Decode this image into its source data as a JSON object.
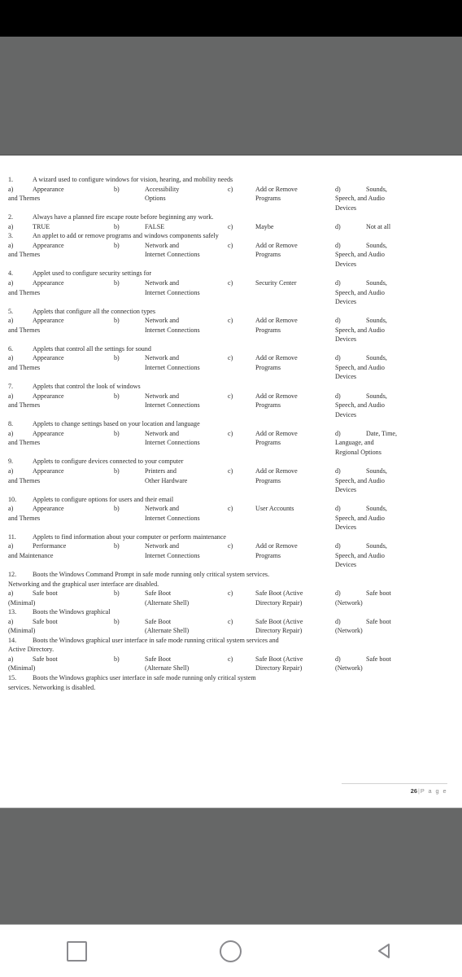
{
  "app": {
    "status_bar_color": "#000000",
    "reader_background_color": "#666767",
    "page_background_color": "#ffffff"
  },
  "document": {
    "footer": {
      "page_number": "26",
      "separator": "|",
      "page_word": "P a g e"
    },
    "questions": [
      {
        "number": "1.",
        "stem": "A wizard used to configure windows for vision, hearing, and mobility needs",
        "options": {
          "a": {
            "letter": "a)",
            "line1": "Appearance",
            "line2": "and Themes",
            "line3": ""
          },
          "b": {
            "letter": "b)",
            "line1": "Accessibility",
            "line2": "Options",
            "line3": ""
          },
          "c": {
            "letter": "c)",
            "line1": "Add or Remove",
            "line2": "Programs",
            "line3": ""
          },
          "d": {
            "letter": "d)",
            "line1": "Sounds,",
            "line2": "Speech, and Audio",
            "line3": "Devices"
          }
        }
      },
      {
        "number": "2.",
        "stem": "Always have a planned fire escape route before beginning any work.",
        "options": {
          "a": {
            "letter": "a)",
            "line1": "TRUE",
            "line2": "",
            "line3": ""
          },
          "b": {
            "letter": "b)",
            "line1": "FALSE",
            "line2": "",
            "line3": ""
          },
          "c": {
            "letter": "c)",
            "line1": "Maybe",
            "line2": "",
            "line3": ""
          },
          "d": {
            "letter": "d)",
            "line1": "Not at all",
            "line2": "",
            "line3": ""
          }
        }
      },
      {
        "number": "3.",
        "stem": "An applet to add or remove programs and windows components safely",
        "options": {
          "a": {
            "letter": "a)",
            "line1": "Appearance",
            "line2": "and Themes",
            "line3": ""
          },
          "b": {
            "letter": "b)",
            "line1": "Network and",
            "line2": "Internet Connections",
            "line3": ""
          },
          "c": {
            "letter": "c)",
            "line1": "Add or Remove",
            "line2": "Programs",
            "line3": ""
          },
          "d": {
            "letter": "d)",
            "line1": "Sounds,",
            "line2": "Speech, and Audio",
            "line3": "Devices"
          }
        }
      },
      {
        "number": "4.",
        "stem": "Applet used to configure security settings for",
        "options": {
          "a": {
            "letter": "a)",
            "line1": "Appearance",
            "line2": "and Themes",
            "line3": ""
          },
          "b": {
            "letter": "b)",
            "line1": "Network and",
            "line2": "Internet Connections",
            "line3": ""
          },
          "c": {
            "letter": "c)",
            "line1": "Security Center",
            "line2": "",
            "line3": ""
          },
          "d": {
            "letter": "d)",
            "line1": "Sounds,",
            "line2": "Speech, and Audio",
            "line3": "Devices"
          }
        }
      },
      {
        "number": "5.",
        "stem": "Applets that configure all the connection types",
        "options": {
          "a": {
            "letter": "a)",
            "line1": "Appearance",
            "line2": "and Themes",
            "line3": ""
          },
          "b": {
            "letter": "b)",
            "line1": "Network and",
            "line2": "Internet Connections",
            "line3": ""
          },
          "c": {
            "letter": "c)",
            "line1": "Add or Remove",
            "line2": "Programs",
            "line3": ""
          },
          "d": {
            "letter": "d)",
            "line1": "Sounds,",
            "line2": "Speech, and Audio",
            "line3": "Devices"
          }
        }
      },
      {
        "number": "6.",
        "stem": "Applets that control all the settings for sound",
        "options": {
          "a": {
            "letter": "a)",
            "line1": "Appearance",
            "line2": "and Themes",
            "line3": ""
          },
          "b": {
            "letter": "b)",
            "line1": "Network and",
            "line2": "Internet Connections",
            "line3": ""
          },
          "c": {
            "letter": "c)",
            "line1": "Add or Remove",
            "line2": "Programs",
            "line3": ""
          },
          "d": {
            "letter": "d)",
            "line1": "Sounds,",
            "line2": "Speech, and Audio",
            "line3": "Devices"
          }
        }
      },
      {
        "number": "7.",
        "stem": "Applets that control the look of windows",
        "options": {
          "a": {
            "letter": "a)",
            "line1": "Appearance",
            "line2": "and Themes",
            "line3": ""
          },
          "b": {
            "letter": "b)",
            "line1": "Network and",
            "line2": "Internet Connections",
            "line3": ""
          },
          "c": {
            "letter": "c)",
            "line1": "Add or Remove",
            "line2": "Programs",
            "line3": ""
          },
          "d": {
            "letter": "d)",
            "line1": "Sounds,",
            "line2": "Speech, and Audio",
            "line3": "Devices"
          }
        }
      },
      {
        "number": "8.",
        "stem": "Applets to change settings based on your location and language",
        "options": {
          "a": {
            "letter": "a)",
            "line1": "Appearance",
            "line2": "and Themes",
            "line3": ""
          },
          "b": {
            "letter": "b)",
            "line1": "Network and",
            "line2": "Internet Connections",
            "line3": ""
          },
          "c": {
            "letter": "c)",
            "line1": "Add or Remove",
            "line2": "Programs",
            "line3": ""
          },
          "d": {
            "letter": "d)",
            "line1": "Date, Time,",
            "line2": "Language, and",
            "line3": "Regional Options"
          }
        }
      },
      {
        "number": "9.",
        "stem": "Applets to configure devices connected to your computer",
        "options": {
          "a": {
            "letter": "a)",
            "line1": "Appearance",
            "line2": "and Themes",
            "line3": ""
          },
          "b": {
            "letter": "b)",
            "line1": "Printers and",
            "line2": "Other Hardware",
            "line3": ""
          },
          "c": {
            "letter": "c)",
            "line1": "Add or Remove",
            "line2": "Programs",
            "line3": ""
          },
          "d": {
            "letter": "d)",
            "line1": "Sounds,",
            "line2": "Speech, and Audio",
            "line3": "Devices"
          }
        }
      },
      {
        "number": "10.",
        "stem": "Applets to configure options for users and their email",
        "options": {
          "a": {
            "letter": "a)",
            "line1": "Appearance",
            "line2": "and Themes",
            "line3": ""
          },
          "b": {
            "letter": "b)",
            "line1": "Network and",
            "line2": "Internet Connections",
            "line3": ""
          },
          "c": {
            "letter": "c)",
            "line1": "User Accounts",
            "line2": "",
            "line3": ""
          },
          "d": {
            "letter": "d)",
            "line1": "Sounds,",
            "line2": "Speech, and Audio",
            "line3": "Devices"
          }
        }
      },
      {
        "number": "11.",
        "stem": "Applets to find information about your computer or perform maintenance",
        "options": {
          "a": {
            "letter": "a)",
            "line1": "Performance",
            "line2": "and Maintenance",
            "line3": ""
          },
          "b": {
            "letter": "b)",
            "line1": "Network and",
            "line2": "Internet Connections",
            "line3": ""
          },
          "c": {
            "letter": "c)",
            "line1": "Add or Remove",
            "line2": "Programs",
            "line3": ""
          },
          "d": {
            "letter": "d)",
            "line1": "Sounds,",
            "line2": "Speech, and Audio",
            "line3": "Devices"
          }
        }
      },
      {
        "number": "12.",
        "stem": "Boots the Windows Command Prompt in safe mode running only critical system services.",
        "stem_line2": "Networking and the graphical user interface are disabled.",
        "options": {
          "a": {
            "letter": "a)",
            "line1": "Safe boot",
            "line2": "(Minimal)",
            "line3": ""
          },
          "b": {
            "letter": "b)",
            "line1": "Safe Boot",
            "line2": "(Alternate Shell)",
            "line3": ""
          },
          "c": {
            "letter": "c)",
            "line1": "Safe Boot (Active",
            "line2": "Directory Repair)",
            "line3": ""
          },
          "d": {
            "letter": "d)",
            "line1": "Safe boot",
            "line2": "(Network)",
            "line3": ""
          }
        }
      },
      {
        "number": "13.",
        "stem": "Boots the Windows graphical",
        "options": {
          "a": {
            "letter": "a)",
            "line1": "Safe boot",
            "line2": "(Minimal)",
            "line3": ""
          },
          "b": {
            "letter": "b)",
            "line1": "Safe Boot",
            "line2": "(Alternate Shell)",
            "line3": ""
          },
          "c": {
            "letter": "c)",
            "line1": "Safe Boot (Active",
            "line2": "Directory Repair)",
            "line3": ""
          },
          "d": {
            "letter": "d)",
            "line1": "Safe boot",
            "line2": "(Network)",
            "line3": ""
          }
        }
      },
      {
        "number": "14.",
        "stem": "Boots the Windows graphical user interface in safe mode running critical system services and",
        "stem_line2": "Active Directory.",
        "options": {
          "a": {
            "letter": "a)",
            "line1": "Safe boot",
            "line2": "(Minimal)",
            "line3": ""
          },
          "b": {
            "letter": "b)",
            "line1": "Safe Boot",
            "line2": "(Alternate Shell)",
            "line3": ""
          },
          "c": {
            "letter": "c)",
            "line1": "Safe Boot (Active",
            "line2": "Directory Repair)",
            "line3": ""
          },
          "d": {
            "letter": "d)",
            "line1": "Safe boot",
            "line2": "(Network)",
            "line3": ""
          }
        }
      },
      {
        "number": "15.",
        "stem": "Boots the Windows graphics user interface in safe mode running only critical system",
        "stem_line2": "services. Networking is disabled.",
        "options": null
      }
    ]
  },
  "nav_bar": {
    "recent_label": "Recent apps",
    "home_label": "Home",
    "back_label": "Back"
  }
}
